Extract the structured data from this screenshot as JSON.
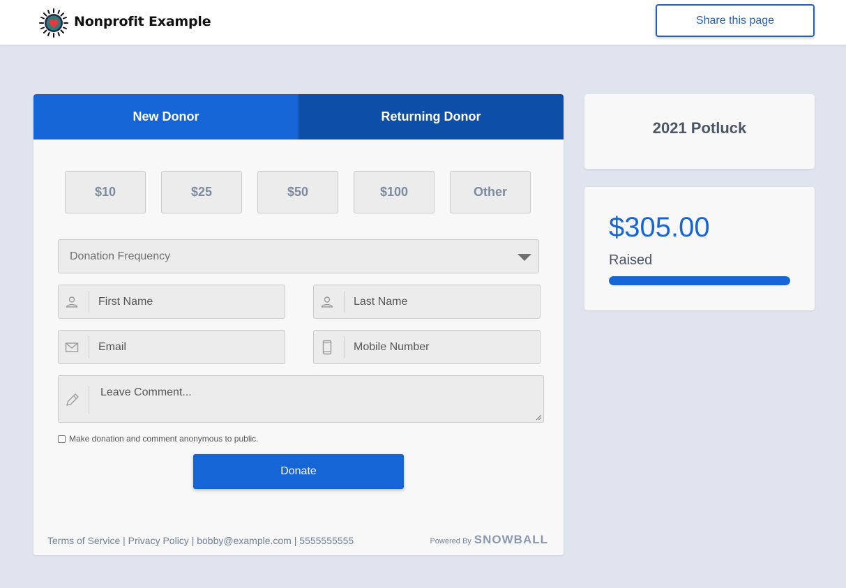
{
  "header": {
    "brand_name": "Nonprofit Example",
    "share_label": "Share this page",
    "logo_icon": "heart-sun-icon"
  },
  "donation_form": {
    "tabs": [
      {
        "label": "New Donor",
        "active": true
      },
      {
        "label": "Returning Donor",
        "active": false
      }
    ],
    "amounts": [
      "$10",
      "$25",
      "$50",
      "$100",
      "Other"
    ],
    "frequency": {
      "placeholder": "Donation Frequency"
    },
    "fields": {
      "first_name": {
        "placeholder": "First Name",
        "icon": "user-icon"
      },
      "last_name": {
        "placeholder": "Last Name",
        "icon": "user-icon"
      },
      "email": {
        "placeholder": "Email",
        "icon": "envelope-icon"
      },
      "mobile": {
        "placeholder": "Mobile Number",
        "icon": "mobile-phone-icon"
      },
      "comment": {
        "placeholder": "Leave Comment...",
        "icon": "pencil-icon"
      }
    },
    "anonymous_label": "Make donation and comment anonymous to public.",
    "anonymous_checked": false,
    "donate_label": "Donate",
    "footer": {
      "terms": "Terms of Service",
      "privacy": "Privacy Policy",
      "email": "bobby@example.com",
      "phone": "5555555555",
      "powered_by": "Powered By",
      "powered_brand": "SNOWBALL"
    }
  },
  "campaign": {
    "title": "2021 Potluck",
    "raised_amount": "$305.00",
    "raised_label": "Raised",
    "progress_percent": 100
  },
  "colors": {
    "primary": "#1565d6",
    "primary_dark": "#0d4ea8",
    "page_bg": "#dfe4ee",
    "text_muted": "#6f7f99"
  }
}
